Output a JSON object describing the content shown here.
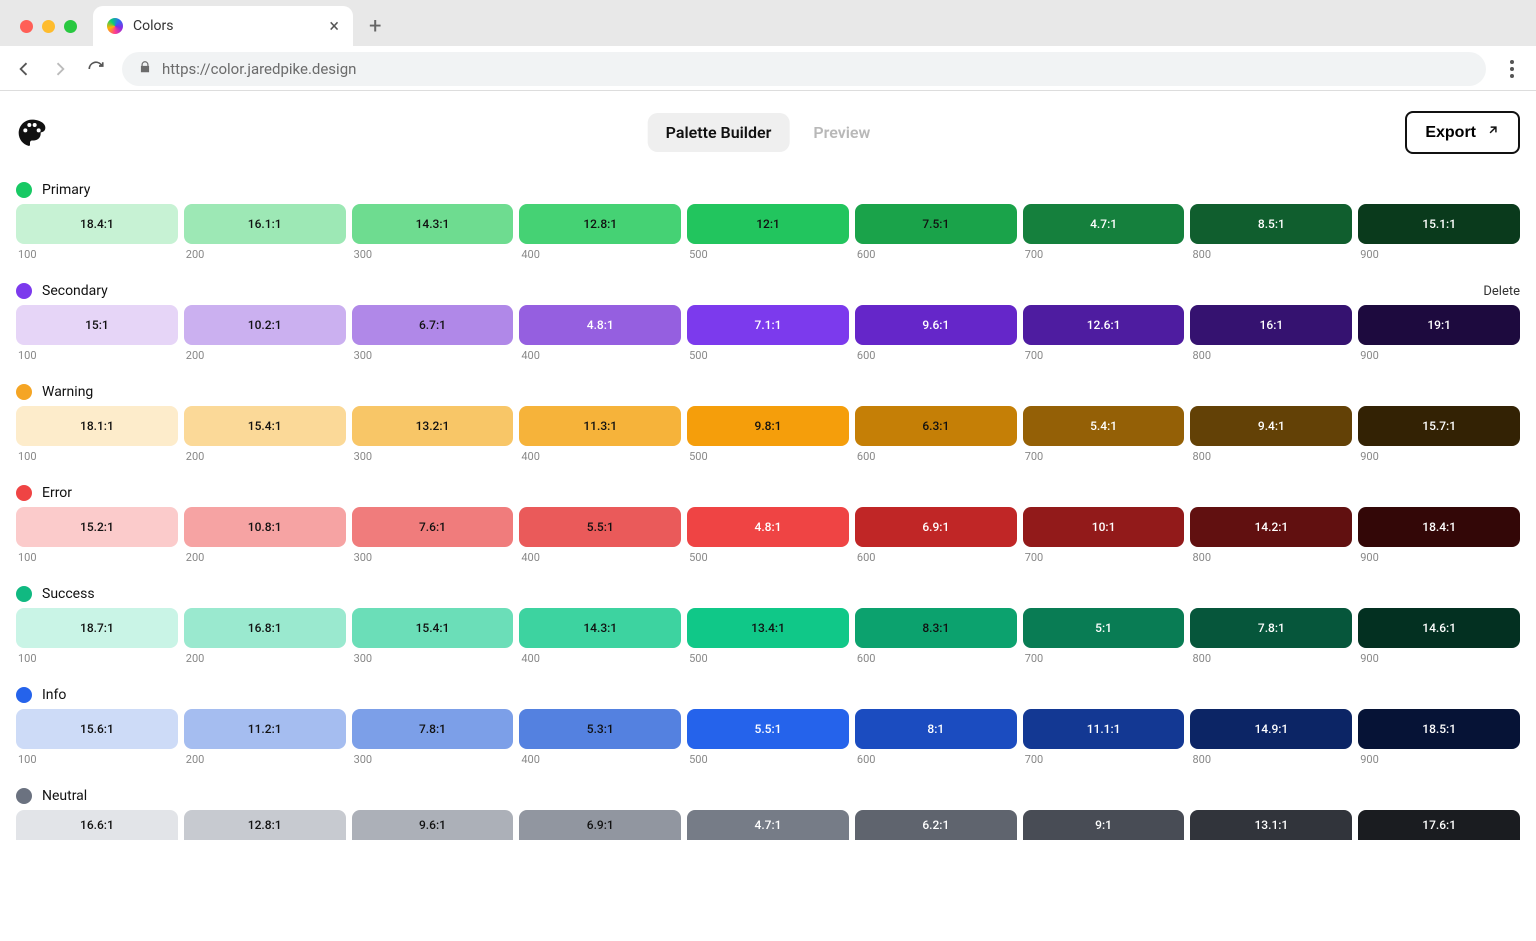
{
  "browser": {
    "tab_title": "Colors",
    "url": "https://color.jaredpike.design"
  },
  "header": {
    "tab_builder": "Palette Builder",
    "tab_preview": "Preview",
    "export_label": "Export"
  },
  "steps": [
    "100",
    "200",
    "300",
    "400",
    "500",
    "600",
    "700",
    "800",
    "900"
  ],
  "delete_label": "Delete",
  "rows": [
    {
      "name": "Primary",
      "dot": "#18c964",
      "show_delete": false,
      "swatches": [
        {
          "bg": "#c7f2d4",
          "fg": "#111",
          "ratio": "18.4:1"
        },
        {
          "bg": "#9de8b5",
          "fg": "#111",
          "ratio": "16.1:1"
        },
        {
          "bg": "#6edc90",
          "fg": "#111",
          "ratio": "14.3:1"
        },
        {
          "bg": "#45d274",
          "fg": "#111",
          "ratio": "12.8:1"
        },
        {
          "bg": "#22c55e",
          "fg": "#111",
          "ratio": "12:1"
        },
        {
          "bg": "#1aa34a",
          "fg": "#111",
          "ratio": "7.5:1"
        },
        {
          "bg": "#15803d",
          "fg": "#fff",
          "ratio": "4.7:1"
        },
        {
          "bg": "#105e2e",
          "fg": "#fff",
          "ratio": "8.5:1"
        },
        {
          "bg": "#0a3a1c",
          "fg": "#fff",
          "ratio": "15.1:1"
        }
      ]
    },
    {
      "name": "Secondary",
      "dot": "#7c3aed",
      "show_delete": true,
      "swatches": [
        {
          "bg": "#e6d5f7",
          "fg": "#111",
          "ratio": "15:1"
        },
        {
          "bg": "#cbb0f0",
          "fg": "#111",
          "ratio": "10.2:1"
        },
        {
          "bg": "#b088e8",
          "fg": "#111",
          "ratio": "6.7:1"
        },
        {
          "bg": "#955fe0",
          "fg": "#fff",
          "ratio": "4.8:1"
        },
        {
          "bg": "#7c3aed",
          "fg": "#fff",
          "ratio": "7.1:1"
        },
        {
          "bg": "#6526c9",
          "fg": "#fff",
          "ratio": "9.6:1"
        },
        {
          "bg": "#4e1ca0",
          "fg": "#fff",
          "ratio": "12.6:1"
        },
        {
          "bg": "#351270",
          "fg": "#fff",
          "ratio": "16:1"
        },
        {
          "bg": "#1d0a3e",
          "fg": "#fff",
          "ratio": "19:1"
        }
      ]
    },
    {
      "name": "Warning",
      "dot": "#f5a524",
      "show_delete": false,
      "swatches": [
        {
          "bg": "#fdeccb",
          "fg": "#111",
          "ratio": "18.1:1"
        },
        {
          "bg": "#fbd998",
          "fg": "#111",
          "ratio": "15.4:1"
        },
        {
          "bg": "#f8c667",
          "fg": "#111",
          "ratio": "13.2:1"
        },
        {
          "bg": "#f6b33a",
          "fg": "#111",
          "ratio": "11.3:1"
        },
        {
          "bg": "#f59e0b",
          "fg": "#111",
          "ratio": "9.8:1"
        },
        {
          "bg": "#c57f06",
          "fg": "#111",
          "ratio": "6.3:1"
        },
        {
          "bg": "#946006",
          "fg": "#fff",
          "ratio": "5.4:1"
        },
        {
          "bg": "#634106",
          "fg": "#fff",
          "ratio": "9.4:1"
        },
        {
          "bg": "#332204",
          "fg": "#fff",
          "ratio": "15.7:1"
        }
      ]
    },
    {
      "name": "Error",
      "dot": "#ef4444",
      "show_delete": false,
      "swatches": [
        {
          "bg": "#fbcbcb",
          "fg": "#111",
          "ratio": "15.2:1"
        },
        {
          "bg": "#f6a3a3",
          "fg": "#111",
          "ratio": "10.8:1"
        },
        {
          "bg": "#f07c7c",
          "fg": "#111",
          "ratio": "7.6:1"
        },
        {
          "bg": "#ea5a5a",
          "fg": "#111",
          "ratio": "5.5:1"
        },
        {
          "bg": "#ef4444",
          "fg": "#fff",
          "ratio": "4.8:1"
        },
        {
          "bg": "#c02626",
          "fg": "#fff",
          "ratio": "6.9:1"
        },
        {
          "bg": "#921a1a",
          "fg": "#fff",
          "ratio": "10:1"
        },
        {
          "bg": "#611010",
          "fg": "#fff",
          "ratio": "14.2:1"
        },
        {
          "bg": "#330707",
          "fg": "#fff",
          "ratio": "18.4:1"
        }
      ]
    },
    {
      "name": "Success",
      "dot": "#10b981",
      "show_delete": false,
      "swatches": [
        {
          "bg": "#c9f4e6",
          "fg": "#111",
          "ratio": "18.7:1"
        },
        {
          "bg": "#9ae9cf",
          "fg": "#111",
          "ratio": "16.8:1"
        },
        {
          "bg": "#6bdeb8",
          "fg": "#111",
          "ratio": "15.4:1"
        },
        {
          "bg": "#3dd3a0",
          "fg": "#111",
          "ratio": "14.3:1"
        },
        {
          "bg": "#10c888",
          "fg": "#111",
          "ratio": "13.4:1"
        },
        {
          "bg": "#0ca26e",
          "fg": "#111",
          "ratio": "8.3:1"
        },
        {
          "bg": "#097c54",
          "fg": "#fff",
          "ratio": "5:1"
        },
        {
          "bg": "#06563b",
          "fg": "#fff",
          "ratio": "7.8:1"
        },
        {
          "bg": "#033021",
          "fg": "#fff",
          "ratio": "14.6:1"
        }
      ]
    },
    {
      "name": "Info",
      "dot": "#2563eb",
      "show_delete": false,
      "swatches": [
        {
          "bg": "#cddbf7",
          "fg": "#111",
          "ratio": "15.6:1"
        },
        {
          "bg": "#a5bdf0",
          "fg": "#111",
          "ratio": "11.2:1"
        },
        {
          "bg": "#7c9fe8",
          "fg": "#111",
          "ratio": "7.8:1"
        },
        {
          "bg": "#5481e0",
          "fg": "#111",
          "ratio": "5.3:1"
        },
        {
          "bg": "#2563eb",
          "fg": "#fff",
          "ratio": "5.5:1"
        },
        {
          "bg": "#1b4cc0",
          "fg": "#fff",
          "ratio": "8:1"
        },
        {
          "bg": "#133893",
          "fg": "#fff",
          "ratio": "11.1:1"
        },
        {
          "bg": "#0c2565",
          "fg": "#fff",
          "ratio": "14.9:1"
        },
        {
          "bg": "#061336",
          "fg": "#fff",
          "ratio": "18.5:1"
        }
      ]
    },
    {
      "name": "Neutral",
      "dot": "#6b7280",
      "show_delete": false,
      "swatches": [
        {
          "bg": "#e2e4e8",
          "fg": "#111",
          "ratio": "16.6:1"
        },
        {
          "bg": "#c7cad0",
          "fg": "#111",
          "ratio": "12.8:1"
        },
        {
          "bg": "#acb0b8",
          "fg": "#111",
          "ratio": "9.6:1"
        },
        {
          "bg": "#9196a0",
          "fg": "#111",
          "ratio": "6.9:1"
        },
        {
          "bg": "#767c87",
          "fg": "#fff",
          "ratio": "4.7:1"
        },
        {
          "bg": "#5f646e",
          "fg": "#fff",
          "ratio": "6.2:1"
        },
        {
          "bg": "#484c55",
          "fg": "#fff",
          "ratio": "9:1"
        },
        {
          "bg": "#31343b",
          "fg": "#fff",
          "ratio": "13.1:1"
        },
        {
          "bg": "#1a1c20",
          "fg": "#fff",
          "ratio": "17.6:1"
        }
      ]
    }
  ]
}
